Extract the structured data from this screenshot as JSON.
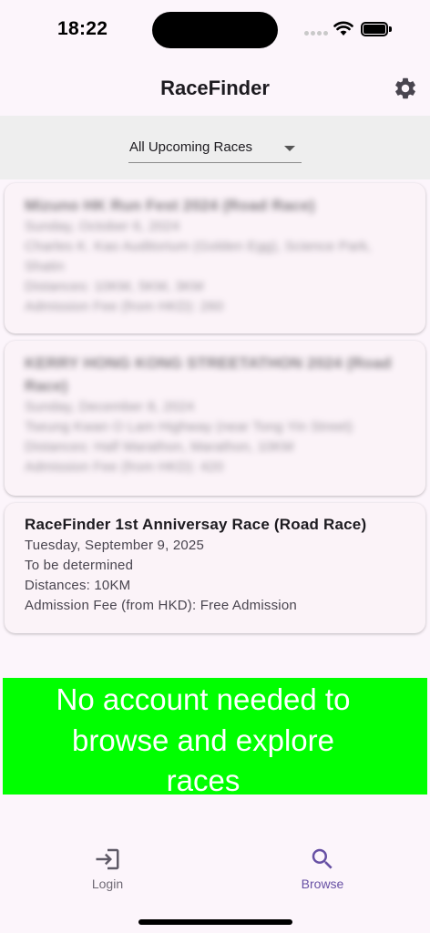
{
  "status_bar": {
    "time": "18:22"
  },
  "app_bar": {
    "title": "RaceFinder",
    "settings_icon": "gear-icon"
  },
  "filter": {
    "selected": "All Upcoming Races"
  },
  "races": [
    {
      "title": "Mizuno HK Run Fest 2024 (Road Race)",
      "date": "Sunday, October 6, 2024",
      "venue": "Charles K. Kao Auditorium (Golden Egg), Science Park, Shatin",
      "distances": "Distances: 10KM, 5KM, 3KM",
      "fee": "Admission Fee (from HKD): 260",
      "blurred": true
    },
    {
      "title": "KERRY HONG KONG STREETATHON 2024 (Road Race)",
      "date": "Sunday, December 8, 2024",
      "venue": "Tseung Kwan O Lam Highway (near Tong Yin Street)",
      "distances": "Distances: Half Marathon, Marathon, 10KM",
      "fee": "Admission Fee (from HKD): 420",
      "blurred": true
    },
    {
      "title": "RaceFinder 1st Anniversay Race (Road Race)",
      "date": "Tuesday, September 9, 2025",
      "venue": "To be determined",
      "distances": "Distances: 10KM",
      "fee": "Admission Fee (from HKD): Free Admission",
      "blurred": false
    }
  ],
  "banner": {
    "lines": [
      "No account needed to",
      "browse and explore",
      "races"
    ],
    "color": "#00ff00"
  },
  "bottom_nav": [
    {
      "label": "Login",
      "icon": "login-icon",
      "active": false
    },
    {
      "label": "Browse",
      "icon": "search-icon",
      "active": true
    }
  ],
  "colors": {
    "accent": "#6750a4",
    "background": "#fcf5fb",
    "filter_bar": "#eeeeee"
  }
}
